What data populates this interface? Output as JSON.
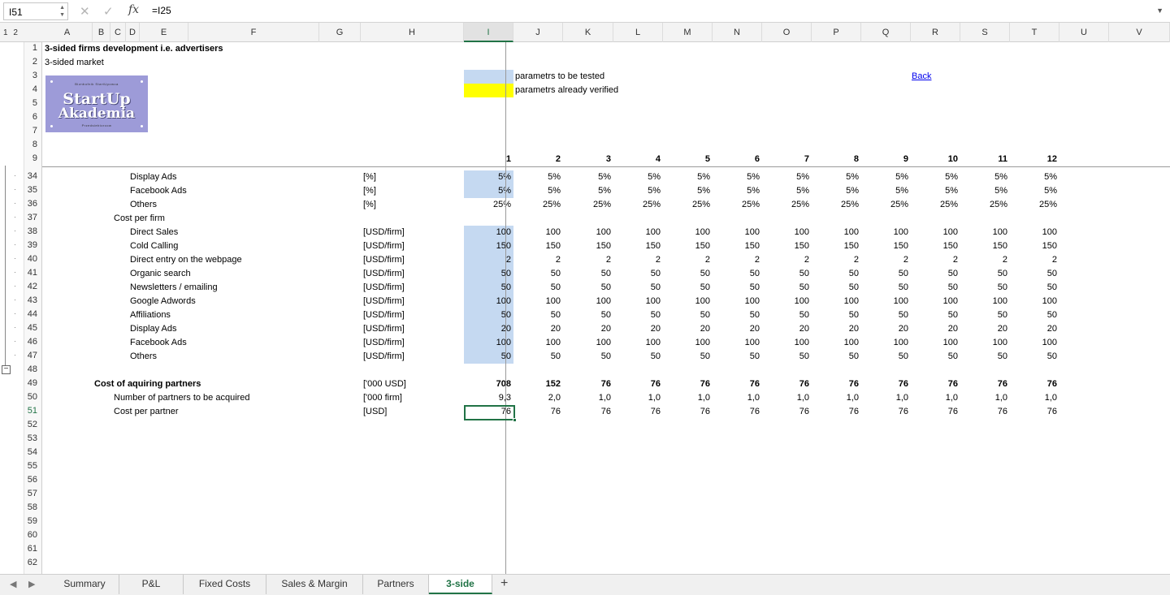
{
  "formula_bar": {
    "name_box": "I51",
    "formula": "=I25",
    "fx_label": "fx",
    "cancel_icon": "✕",
    "enter_icon": "✓"
  },
  "column_headers": [
    "A",
    "B",
    "C",
    "D",
    "E",
    "F",
    "G",
    "H",
    "I",
    "J",
    "K",
    "L",
    "M",
    "N",
    "O",
    "P",
    "Q",
    "R",
    "S",
    "T",
    "U",
    "V"
  ],
  "outline_levels": "1 2",
  "header_rows": {
    "title": "3-sided firms development i.e. advertisers",
    "subtitle": "3-sided market",
    "legend_tested": "parametrs to be tested",
    "legend_verified": "parametrs already verified",
    "back_link": "Back"
  },
  "logo": {
    "top_line": "Biznbofnik StartUpowca",
    "line1": "StartUp",
    "line2": "Akademia",
    "bottom_line": "Przedsiebiorcow"
  },
  "row_numbers_top": [
    "1",
    "2",
    "3",
    "4",
    "5",
    "6",
    "7",
    "8",
    "9"
  ],
  "period_headers": [
    "1",
    "2",
    "3",
    "4",
    "5",
    "6",
    "7",
    "8",
    "9",
    "10",
    "11",
    "12"
  ],
  "rows": [
    {
      "row": "34",
      "label": "Display Ads",
      "indent": 3,
      "unit": "[%]",
      "values": [
        "5%",
        "5%",
        "5%",
        "5%",
        "5%",
        "5%",
        "5%",
        "5%",
        "5%",
        "5%",
        "5%",
        "5%"
      ],
      "blue": true
    },
    {
      "row": "35",
      "label": "Facebook Ads",
      "indent": 3,
      "unit": "[%]",
      "values": [
        "5%",
        "5%",
        "5%",
        "5%",
        "5%",
        "5%",
        "5%",
        "5%",
        "5%",
        "5%",
        "5%",
        "5%"
      ],
      "blue": true
    },
    {
      "row": "36",
      "label": "Others",
      "indent": 3,
      "unit": "[%]",
      "values": [
        "25%",
        "25%",
        "25%",
        "25%",
        "25%",
        "25%",
        "25%",
        "25%",
        "25%",
        "25%",
        "25%",
        "25%"
      ],
      "blue": false
    },
    {
      "row": "37",
      "label": "Cost per firm",
      "indent": 2,
      "unit": "",
      "values": [],
      "blue": false
    },
    {
      "row": "38",
      "label": "Direct Sales",
      "indent": 3,
      "unit": "[USD/firm]",
      "values": [
        "100",
        "100",
        "100",
        "100",
        "100",
        "100",
        "100",
        "100",
        "100",
        "100",
        "100",
        "100"
      ],
      "blue": true
    },
    {
      "row": "39",
      "label": "Cold Calling",
      "indent": 3,
      "unit": "[USD/firm]",
      "values": [
        "150",
        "150",
        "150",
        "150",
        "150",
        "150",
        "150",
        "150",
        "150",
        "150",
        "150",
        "150"
      ],
      "blue": true
    },
    {
      "row": "40",
      "label": "Direct entry on the webpage",
      "indent": 3,
      "unit": "[USD/firm]",
      "values": [
        "2",
        "2",
        "2",
        "2",
        "2",
        "2",
        "2",
        "2",
        "2",
        "2",
        "2",
        "2"
      ],
      "blue": true
    },
    {
      "row": "41",
      "label": "Organic search",
      "indent": 3,
      "unit": "[USD/firm]",
      "values": [
        "50",
        "50",
        "50",
        "50",
        "50",
        "50",
        "50",
        "50",
        "50",
        "50",
        "50",
        "50"
      ],
      "blue": true
    },
    {
      "row": "42",
      "label": "Newsletters / emailing",
      "indent": 3,
      "unit": "[USD/firm]",
      "values": [
        "50",
        "50",
        "50",
        "50",
        "50",
        "50",
        "50",
        "50",
        "50",
        "50",
        "50",
        "50"
      ],
      "blue": true
    },
    {
      "row": "43",
      "label": "Google Adwords",
      "indent": 3,
      "unit": "[USD/firm]",
      "values": [
        "100",
        "100",
        "100",
        "100",
        "100",
        "100",
        "100",
        "100",
        "100",
        "100",
        "100",
        "100"
      ],
      "blue": true
    },
    {
      "row": "44",
      "label": "Affiliations",
      "indent": 3,
      "unit": "[USD/firm]",
      "values": [
        "50",
        "50",
        "50",
        "50",
        "50",
        "50",
        "50",
        "50",
        "50",
        "50",
        "50",
        "50"
      ],
      "blue": true
    },
    {
      "row": "45",
      "label": "Display Ads",
      "indent": 3,
      "unit": "[USD/firm]",
      "values": [
        "20",
        "20",
        "20",
        "20",
        "20",
        "20",
        "20",
        "20",
        "20",
        "20",
        "20",
        "20"
      ],
      "blue": true
    },
    {
      "row": "46",
      "label": "Facebook Ads",
      "indent": 3,
      "unit": "[USD/firm]",
      "values": [
        "100",
        "100",
        "100",
        "100",
        "100",
        "100",
        "100",
        "100",
        "100",
        "100",
        "100",
        "100"
      ],
      "blue": true
    },
    {
      "row": "47",
      "label": "Others",
      "indent": 3,
      "unit": "[USD/firm]",
      "values": [
        "50",
        "50",
        "50",
        "50",
        "50",
        "50",
        "50",
        "50",
        "50",
        "50",
        "50",
        "50"
      ],
      "blue": true
    },
    {
      "row": "48",
      "label": "",
      "indent": 0,
      "unit": "",
      "values": [],
      "blue": false
    },
    {
      "row": "49",
      "label": "Cost of aquiring partners",
      "indent": 1,
      "unit": "['000 USD]",
      "values": [
        "708",
        "152",
        "76",
        "76",
        "76",
        "76",
        "76",
        "76",
        "76",
        "76",
        "76",
        "76"
      ],
      "blue": false,
      "bold": true
    },
    {
      "row": "50",
      "label": "Number of partners to be acquired",
      "indent": 2,
      "unit": "['000 firm]",
      "values": [
        "9,3",
        "2,0",
        "1,0",
        "1,0",
        "1,0",
        "1,0",
        "1,0",
        "1,0",
        "1,0",
        "1,0",
        "1,0",
        "1,0"
      ],
      "blue": false
    },
    {
      "row": "51",
      "label": "Cost per partner",
      "indent": 2,
      "unit": "[USD]",
      "values": [
        "76",
        "76",
        "76",
        "76",
        "76",
        "76",
        "76",
        "76",
        "76",
        "76",
        "76",
        "76"
      ],
      "blue": false
    },
    {
      "row": "52",
      "label": "",
      "indent": 0,
      "unit": "",
      "values": [],
      "blue": false
    },
    {
      "row": "53",
      "label": "",
      "indent": 0,
      "unit": "",
      "values": [],
      "blue": false
    },
    {
      "row": "54",
      "label": "",
      "indent": 0,
      "unit": "",
      "values": [],
      "blue": false
    },
    {
      "row": "55",
      "label": "",
      "indent": 0,
      "unit": "",
      "values": [],
      "blue": false
    },
    {
      "row": "56",
      "label": "",
      "indent": 0,
      "unit": "",
      "values": [],
      "blue": false
    },
    {
      "row": "57",
      "label": "",
      "indent": 0,
      "unit": "",
      "values": [],
      "blue": false
    },
    {
      "row": "58",
      "label": "",
      "indent": 0,
      "unit": "",
      "values": [],
      "blue": false
    },
    {
      "row": "59",
      "label": "",
      "indent": 0,
      "unit": "",
      "values": [],
      "blue": false
    },
    {
      "row": "60",
      "label": "",
      "indent": 0,
      "unit": "",
      "values": [],
      "blue": false
    },
    {
      "row": "61",
      "label": "",
      "indent": 0,
      "unit": "",
      "values": [],
      "blue": false
    },
    {
      "row": "62",
      "label": "",
      "indent": 0,
      "unit": "",
      "values": [],
      "blue": false
    }
  ],
  "selected_cell": {
    "column": "I",
    "row": "51"
  },
  "sheet_tabs": [
    {
      "label": "Summary",
      "active": false
    },
    {
      "label": "P&L",
      "active": false
    },
    {
      "label": "Fixed Costs",
      "active": false
    },
    {
      "label": "Sales & Margin",
      "active": false
    },
    {
      "label": "Partners",
      "active": false
    },
    {
      "label": "3-side",
      "active": true
    }
  ],
  "add_sheet": "+",
  "colors": {
    "accent": "#217346",
    "param_tested": "#c5d9f1",
    "param_verified": "#ffff00",
    "logo_bg": "#9d9bd8"
  }
}
